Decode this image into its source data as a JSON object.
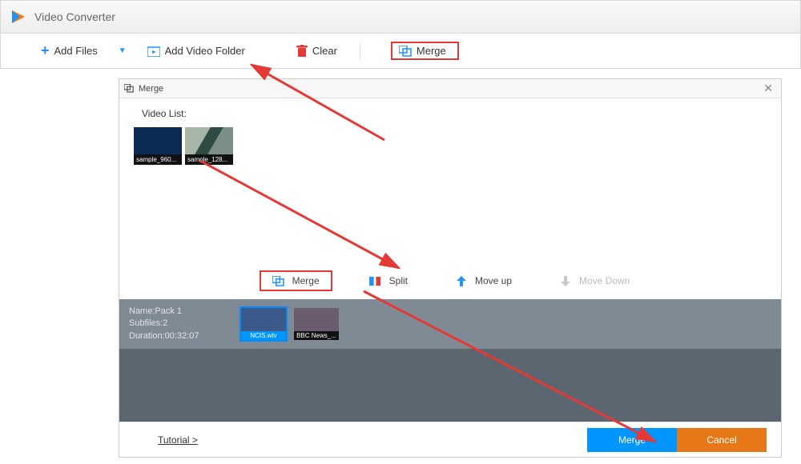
{
  "app": {
    "title": "Video Converter"
  },
  "toolbar": {
    "add_files": "Add Files",
    "add_folder": "Add Video Folder",
    "clear": "Clear",
    "merge": "Merge"
  },
  "dialog": {
    "title": "Merge",
    "video_list_label": "Video List:",
    "list_items": [
      {
        "label": "sample_960..."
      },
      {
        "label": "sample_128..."
      }
    ],
    "actions": {
      "merge": "Merge",
      "split": "Split",
      "move_up": "Move up",
      "move_down": "Move Down"
    },
    "pack": {
      "name_label": "Name:",
      "name_value": "Pack 1",
      "subfiles_label": "Subfiles:",
      "subfiles_value": "2",
      "duration_label": "Duration:",
      "duration_value": "00:32:07",
      "items": [
        {
          "label": "NCIS.wtv"
        },
        {
          "label": "BBC News_..."
        }
      ]
    },
    "footer": {
      "tutorial": "Tutorial >",
      "merge": "Merge",
      "cancel": "Cancel"
    }
  },
  "colors": {
    "accent_blue": "#0095ff",
    "accent_orange": "#e67817",
    "highlight_red": "#e53935"
  }
}
